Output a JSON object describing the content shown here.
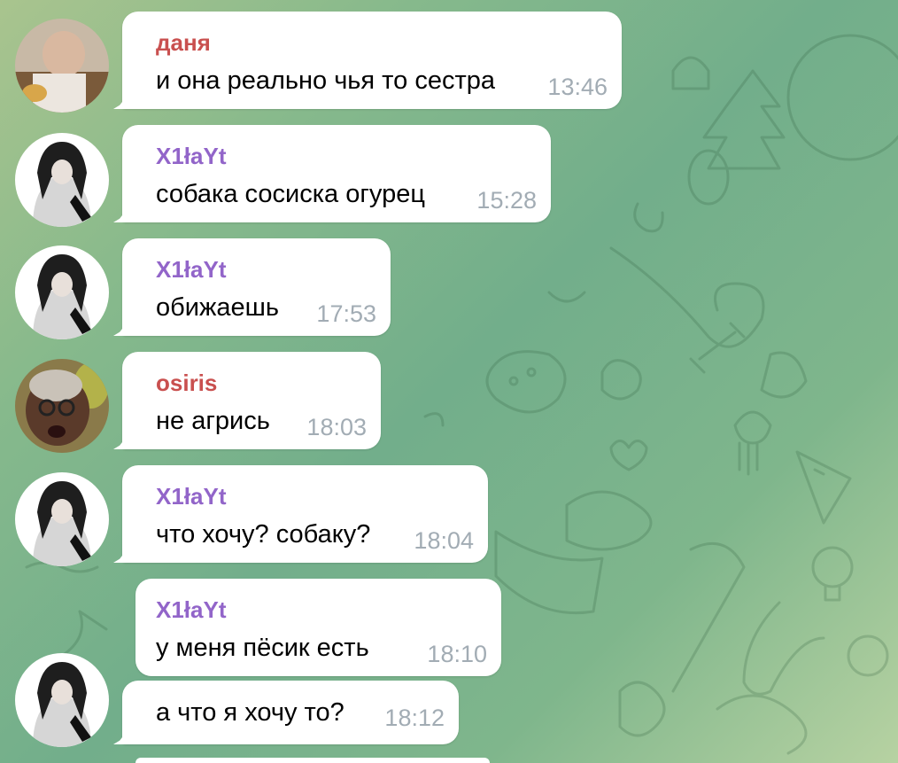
{
  "colors": {
    "bubble_bg": "#ffffff",
    "message_text": "#000000",
    "time_text": "#a2acb4"
  },
  "messages": [
    {
      "sender": "даня",
      "sender_color": "#c9504f",
      "text": "и она реально чья то сестра",
      "time": "13:46",
      "avatar": "photo-man-avatar"
    },
    {
      "sender": "X1łaYt",
      "sender_color": "#9265c9",
      "text": "собака сосиска огурец",
      "time": "15:28",
      "avatar": "photo-dark-hair-avatar"
    },
    {
      "sender": "X1łaYt",
      "sender_color": "#9265c9",
      "text": "обижаешь",
      "time": "17:53",
      "avatar": "photo-dark-hair-avatar"
    },
    {
      "sender": "osiris",
      "sender_color": "#c9504f",
      "text": "не агрись",
      "time": "18:03",
      "avatar": "photo-glasses-avatar"
    },
    {
      "sender": "X1łaYt",
      "sender_color": "#9265c9",
      "text": "что хочу? собаку?",
      "time": "18:04",
      "avatar": "photo-dark-hair-avatar"
    },
    {
      "sender": "X1łaYt",
      "sender_color": "#9265c9",
      "text": "у меня пёсик есть",
      "time": "18:10"
    },
    {
      "text": "а что я хочу то?",
      "time": "18:12",
      "avatar": "photo-dark-hair-avatar"
    }
  ]
}
